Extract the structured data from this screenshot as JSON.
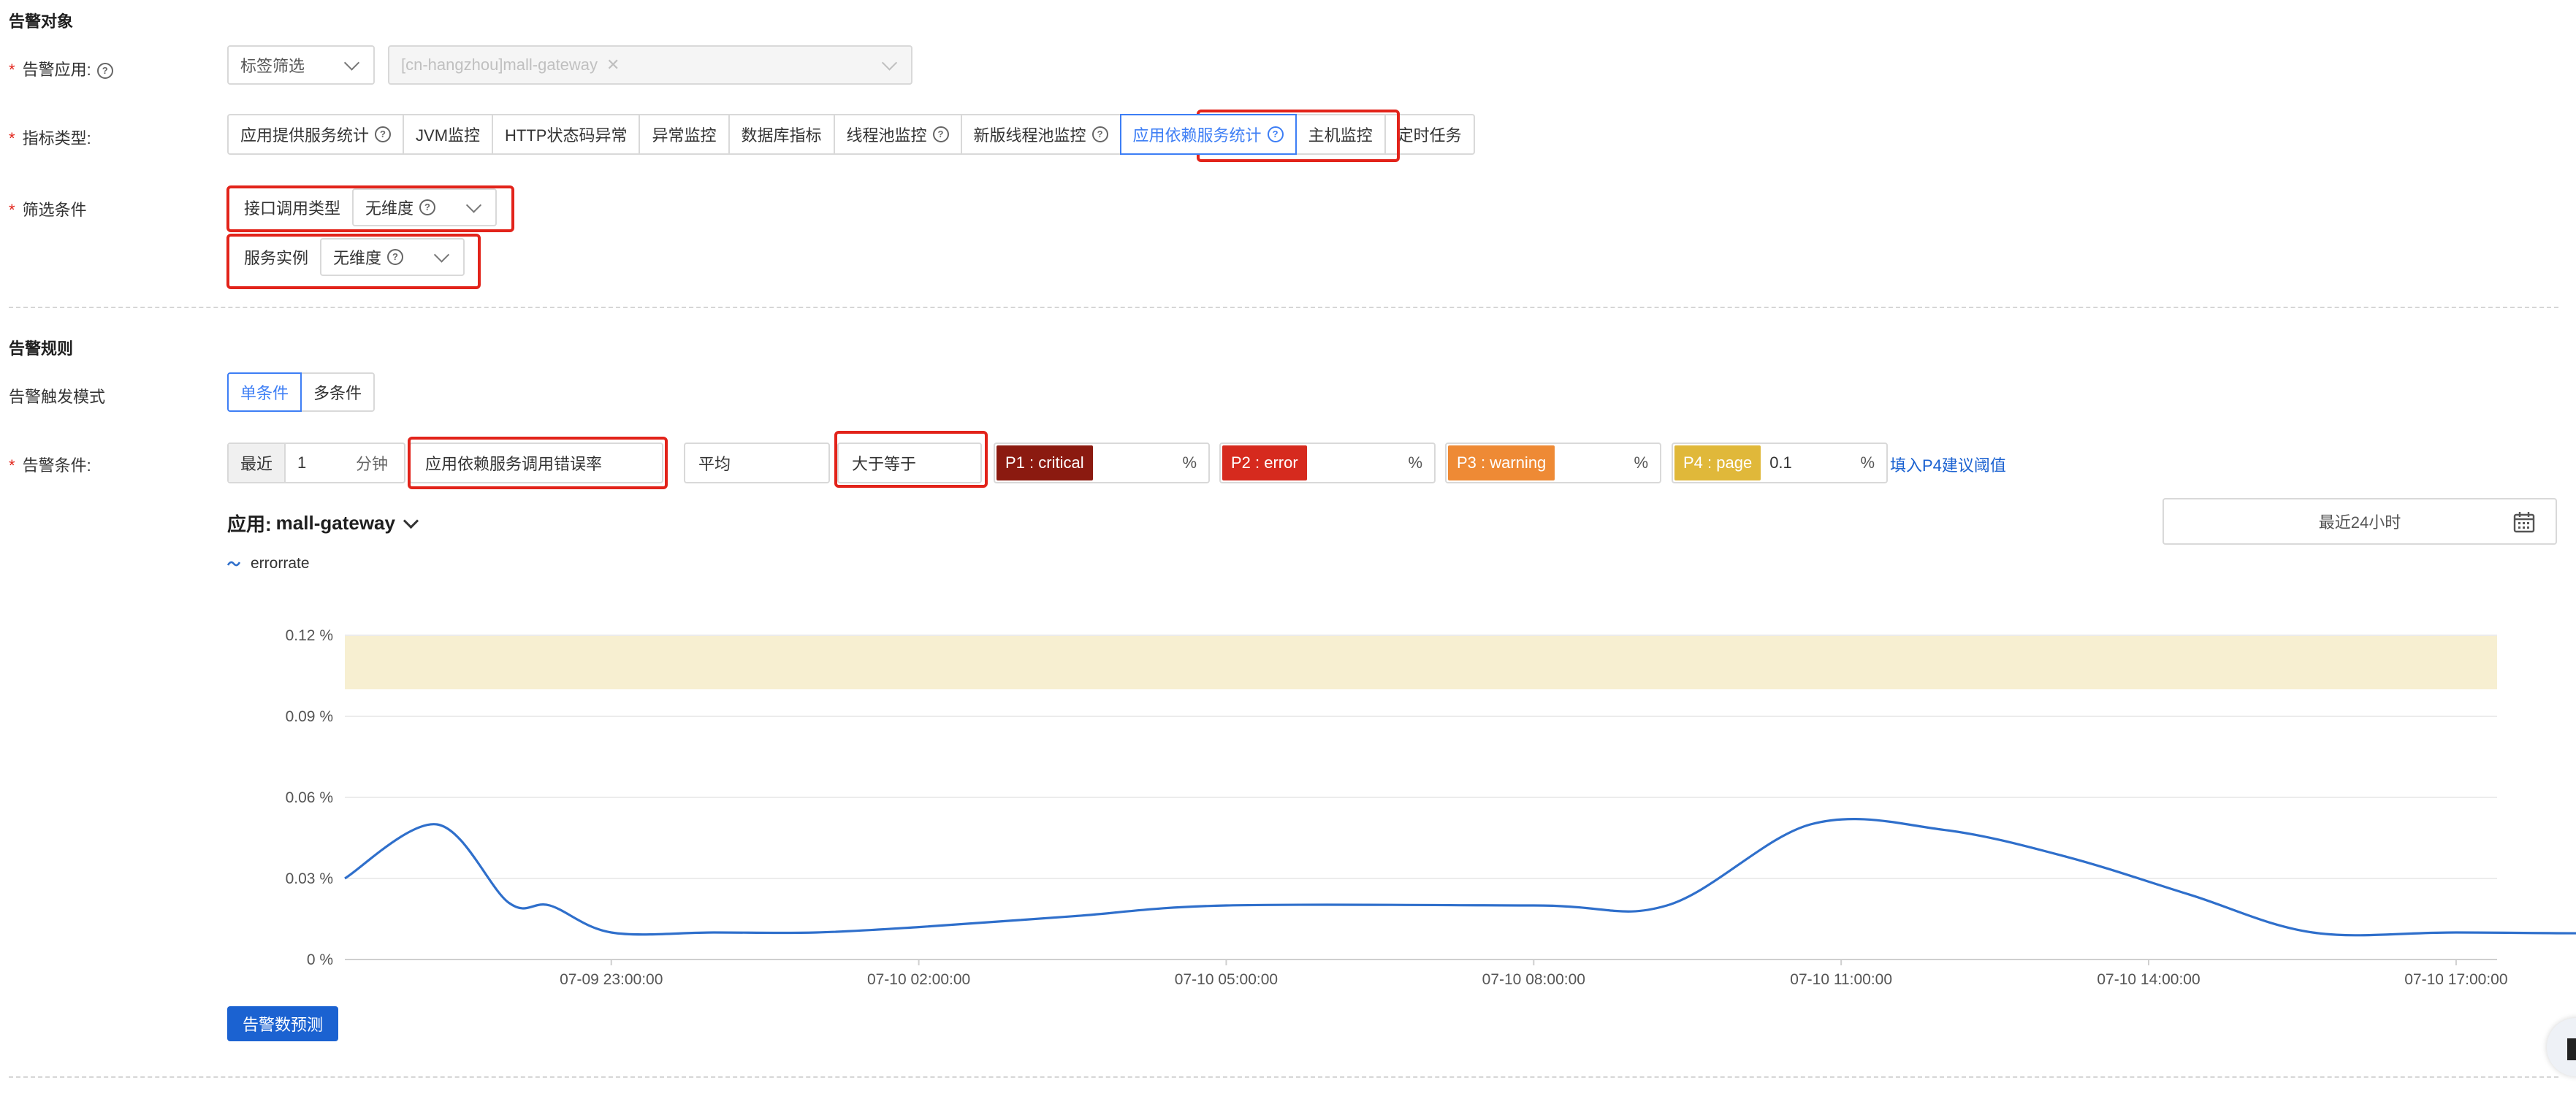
{
  "target": {
    "section_title": "告警对象",
    "app_label": "告警应用:",
    "tag_filter_value": "标签筛选",
    "app_tag_value": "[cn-hangzhou]mall-gateway",
    "metric_type_label": "指标类型:",
    "metric_tabs": [
      {
        "label": "应用提供服务统计",
        "help": true,
        "active": false
      },
      {
        "label": "JVM监控",
        "help": false,
        "active": false
      },
      {
        "label": "HTTP状态码异常",
        "help": false,
        "active": false
      },
      {
        "label": "异常监控",
        "help": false,
        "active": false
      },
      {
        "label": "数据库指标",
        "help": false,
        "active": false
      },
      {
        "label": "线程池监控",
        "help": true,
        "active": false
      },
      {
        "label": "新版线程池监控",
        "help": true,
        "active": false
      },
      {
        "label": "应用依赖服务统计",
        "help": true,
        "active": true
      },
      {
        "label": "主机监控",
        "help": false,
        "active": false
      },
      {
        "label": "定时任务",
        "help": false,
        "active": false
      }
    ],
    "filter_label": "筛选条件",
    "filters": [
      {
        "label": "接口调用类型",
        "value": "无维度"
      },
      {
        "label": "服务实例",
        "value": "无维度"
      }
    ]
  },
  "rules": {
    "section_title": "告警规则",
    "trigger_mode_label": "告警触发模式",
    "trigger_modes": [
      "单条件",
      "多条件"
    ],
    "active_mode": "单条件",
    "condition_label": "告警条件:",
    "recent_label": "最近",
    "window_value": "1",
    "window_unit": "分钟",
    "metric_value": "应用依赖服务调用错误率",
    "aggregate_value": "平均",
    "operator_value": "大于等于",
    "levels": [
      {
        "label": "P1 : critical",
        "value": "",
        "unit": "%",
        "color": "#8b1a10"
      },
      {
        "label": "P2 : error",
        "value": "",
        "unit": "%",
        "color": "#d62a1e"
      },
      {
        "label": "P3 : warning",
        "value": "",
        "unit": "%",
        "color": "#ee8a35"
      },
      {
        "label": "P4 : page",
        "value": "0.1",
        "unit": "%",
        "color": "#e0b83a"
      }
    ],
    "suggest_link": "填入P4建议阈值"
  },
  "chart_header": {
    "app_prefix": "应用:",
    "app_name": "mall-gateway",
    "time_range": "最近24小时",
    "legend_icon": "wave-icon"
  },
  "chart_data": {
    "type": "line",
    "title": "",
    "xlabel": "",
    "ylabel": "",
    "x_ticks": [
      "07-09 23:00:00",
      "07-10 02:00:00",
      "07-10 05:00:00",
      "07-10 08:00:00",
      "07-10 11:00:00",
      "07-10 14:00:00",
      "07-10 17:00:00"
    ],
    "y_ticks": [
      "0 %",
      "0.03 %",
      "0.06 %",
      "0.09 %",
      "0.12 %"
    ],
    "ylim": [
      0,
      0.12
    ],
    "x_range_hours": [
      -2.6,
      18.4
    ],
    "threshold_band": {
      "from": 0.1,
      "to": 0.12,
      "color": "#f7efd1"
    },
    "grid": true,
    "legend_position": "top-left",
    "series": [
      {
        "name": "errorrate",
        "color": "#2f6fcb",
        "points": [
          [
            -2.6,
            0.03
          ],
          [
            -1.7,
            0.05
          ],
          [
            -1.0,
            0.021
          ],
          [
            -0.6,
            0.02
          ],
          [
            0.0,
            0.01
          ],
          [
            1.0,
            0.01
          ],
          [
            2.0,
            0.01
          ],
          [
            3.0,
            0.012
          ],
          [
            4.5,
            0.016
          ],
          [
            6.0,
            0.02
          ],
          [
            9.0,
            0.02
          ],
          [
            10.3,
            0.02
          ],
          [
            11.7,
            0.05
          ],
          [
            13.0,
            0.048
          ],
          [
            14.2,
            0.038
          ],
          [
            15.4,
            0.024
          ],
          [
            16.6,
            0.01
          ],
          [
            18.0,
            0.01
          ],
          [
            20.0,
            0.01
          ],
          [
            22.5,
            0.014
          ],
          [
            24.0,
            0.017
          ],
          [
            25.2,
            0.02
          ]
        ]
      }
    ]
  },
  "forecast_button": "告警数预测"
}
